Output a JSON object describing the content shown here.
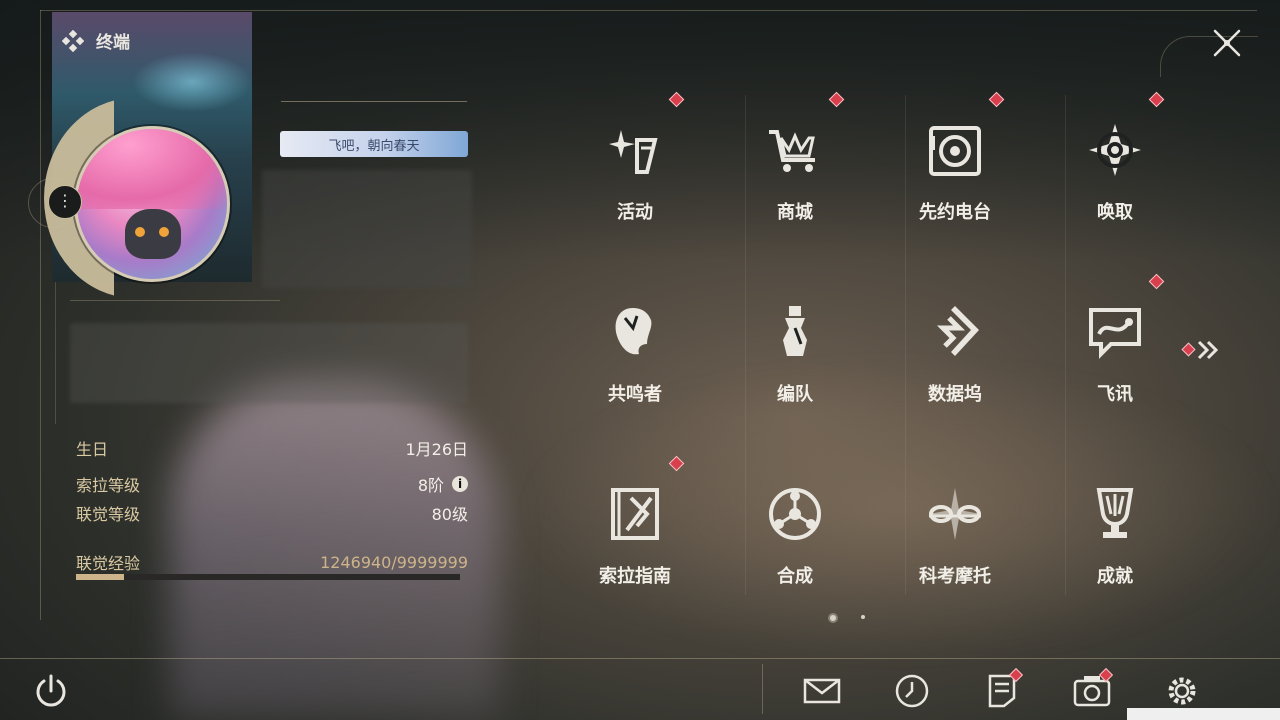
{
  "header": {
    "title": "终端",
    "title_icon": "diamond-cluster-icon",
    "close_icon": "close-icon"
  },
  "profile": {
    "title_badge": "飞吧，朝向春天",
    "menu_icon": "more-vertical-icon",
    "stats": [
      {
        "label": "生日",
        "value": "1月26日"
      },
      {
        "label": "索拉等级",
        "value": "8阶",
        "info_icon": "info-icon"
      },
      {
        "label": "联觉等级",
        "value": "80级"
      }
    ],
    "exp": {
      "label": "联觉经验",
      "value": "1246940/9999999",
      "progress": 0.125
    }
  },
  "grid": [
    {
      "label": "活动",
      "icon": "sparkle-icon",
      "badge": true
    },
    {
      "label": "商城",
      "icon": "shop-cart-icon",
      "badge": true
    },
    {
      "label": "先约电台",
      "icon": "radio-icon",
      "badge": true
    },
    {
      "label": "唤取",
      "icon": "compass-star-icon",
      "badge": true
    },
    {
      "label": "共鸣者",
      "icon": "resonator-head-icon",
      "badge": false
    },
    {
      "label": "编队",
      "icon": "chess-team-icon",
      "badge": false
    },
    {
      "label": "数据坞",
      "icon": "data-dock-icon",
      "badge": false
    },
    {
      "label": "飞讯",
      "icon": "message-icon",
      "badge": true
    },
    {
      "label": "索拉指南",
      "icon": "guide-book-icon",
      "badge": true
    },
    {
      "label": "合成",
      "icon": "synthesis-icon",
      "badge": false
    },
    {
      "label": "科考摩托",
      "icon": "motorcycle-icon",
      "badge": false
    },
    {
      "label": "成就",
      "icon": "trophy-icon",
      "badge": false
    }
  ],
  "pagination": {
    "pages": 2,
    "current": 1,
    "next_icon": "double-chevron-right-icon"
  },
  "bottom_bar": {
    "power_icon": "power-icon",
    "buttons": [
      {
        "icon": "mail-icon",
        "badge": false
      },
      {
        "icon": "clock-icon",
        "badge": false
      },
      {
        "icon": "notes-icon",
        "badge": true
      },
      {
        "icon": "camera-icon",
        "badge": true
      },
      {
        "icon": "settings-gear-icon",
        "badge": false
      }
    ]
  },
  "colors": {
    "accent_gold": "#cdb48a",
    "badge_red": "#d8404e",
    "text": "#f2efe8"
  }
}
